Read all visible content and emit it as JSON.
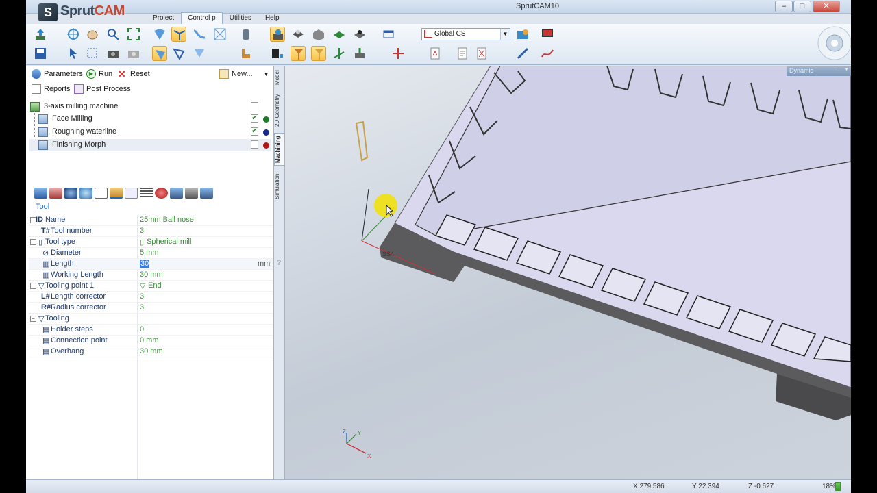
{
  "window": {
    "title": "SprutCAM10",
    "minimize": "–",
    "maximize": "□",
    "close": "✕"
  },
  "logo": {
    "mark": "S",
    "text_a": "Sprut",
    "text_b": "CAM"
  },
  "menu": {
    "tabs": [
      "Project",
      "Control",
      "Utilities",
      "Help"
    ],
    "active": "Control"
  },
  "ribbon": {
    "coordinate_system": "Global CS"
  },
  "operations": {
    "parameters": "Parameters",
    "run": "Run",
    "reset": "Reset",
    "new": "New...",
    "reports": "Reports",
    "post_process": "Post Process"
  },
  "tree": {
    "machine": "3-axis milling machine",
    "items": [
      {
        "label": "Face Milling",
        "checked": true,
        "dot": "#1e7a2a"
      },
      {
        "label": "Roughing waterline",
        "checked": true,
        "dot": "#1a2a8a"
      },
      {
        "label": "Finishing Morph",
        "checked": false,
        "dot": "#b01818"
      }
    ]
  },
  "side_tabs": [
    "Model",
    "2D Geometry",
    "Machining",
    "Simulation"
  ],
  "tool_section": "Tool",
  "properties": [
    {
      "prefix": "ID",
      "name": "Name",
      "value": "25mm Ball nose",
      "level": 0,
      "expander": "−"
    },
    {
      "prefix": "T#",
      "name": "Tool number",
      "value": "3",
      "level": 1
    },
    {
      "prefix": "",
      "name": "Tool type",
      "value": "Spherical mill",
      "level": 0,
      "expander": "−"
    },
    {
      "prefix": "",
      "name": "Diameter",
      "value": "5 mm",
      "level": 1
    },
    {
      "prefix": "",
      "name": "Length",
      "value": "30",
      "unit": "mm",
      "level": 1,
      "editing": true
    },
    {
      "prefix": "",
      "name": "Working Length",
      "value": "30 mm",
      "level": 1
    },
    {
      "prefix": "",
      "name": "Tooling point 1",
      "value": "End",
      "level": 0,
      "expander": "−"
    },
    {
      "prefix": "L#",
      "name": "Length corrector",
      "value": "3",
      "level": 1
    },
    {
      "prefix": "R#",
      "name": "Radius corrector",
      "value": "3",
      "level": 1
    },
    {
      "prefix": "",
      "name": "Tooling",
      "value": "",
      "level": 0,
      "expander": "−"
    },
    {
      "prefix": "",
      "name": "Holder steps",
      "value": "0",
      "level": 1
    },
    {
      "prefix": "",
      "name": "Connection point",
      "value": "0 mm",
      "level": 1
    },
    {
      "prefix": "",
      "name": "Overhang",
      "value": "30 mm",
      "level": 1
    }
  ],
  "viewport": {
    "view_mode": "Dynamic",
    "part_label": "SS4",
    "axis_x": "X",
    "axis_y": "Y",
    "axis_z": "Z"
  },
  "status": {
    "x": "X 279.586",
    "y": "Y 22.394",
    "z": "Z -0.627",
    "zoom": "18%"
  },
  "help": "?"
}
